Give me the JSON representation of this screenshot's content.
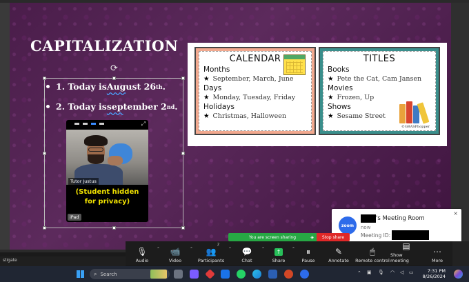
{
  "slide": {
    "title": "CAPITALIZATION",
    "rotate_glyph": "⟳",
    "bullets": [
      {
        "prefix": "1. Today is ",
        "marked": "Aug",
        "rest": "ust 26",
        "sup": "th",
        "end": "."
      },
      {
        "prefix": "2. Today is ",
        "marked": "sep",
        "rest": "tember 2",
        "sup": "nd",
        "end": "."
      }
    ]
  },
  "video": {
    "name_label": "Tutor Justus",
    "hidden_line1": "(Student hidden",
    "hidden_line2": "for privacy)",
    "device_label": "iPad"
  },
  "cards": {
    "calendar": {
      "title": "CALENDAR",
      "sections": [
        {
          "heading": "Months",
          "example": "September, March, June"
        },
        {
          "heading": "Days",
          "example": "Monday, Tuesday, Friday"
        },
        {
          "heading": "Holidays",
          "example": "Christmas, Halloween"
        }
      ]
    },
    "titles": {
      "title": "TITLES",
      "sections": [
        {
          "heading": "Books",
          "example": "Pete the Cat, Cam Jansen"
        },
        {
          "heading": "Movies",
          "example": "Frozen, Up"
        },
        {
          "heading": "Shows",
          "example": "Sesame Street"
        }
      ]
    },
    "star": "★",
    "copyright": "©GRASPhopper"
  },
  "notification": {
    "logo_text": "zoom",
    "room_suffix": "'s Meeting Room",
    "time": "now",
    "meeting_id_label": "Meeting ID:",
    "close": "×"
  },
  "sharing": {
    "banner": "You are screen sharing",
    "stop": "Stop share"
  },
  "toolbar": {
    "participants_count": "2",
    "buttons": [
      {
        "id": "audio",
        "label": "Audio",
        "icon": "🎙"
      },
      {
        "id": "video",
        "label": "Video",
        "icon": "📹"
      },
      {
        "id": "participants",
        "label": "Participants",
        "icon": "👥"
      },
      {
        "id": "chat",
        "label": "Chat",
        "icon": "💬"
      },
      {
        "id": "share",
        "label": "Share",
        "icon": "↑"
      },
      {
        "id": "pause",
        "label": "Pause",
        "icon": "⏸"
      },
      {
        "id": "annotate",
        "label": "Annotate",
        "icon": "✎"
      },
      {
        "id": "remote",
        "label": "Remote control",
        "icon": "🖱"
      },
      {
        "id": "show_meeting",
        "label": "Show meeting",
        "icon": "▤"
      },
      {
        "id": "more",
        "label": "More",
        "icon": "⋯"
      }
    ]
  },
  "left_strip_text": "stigate",
  "taskbar": {
    "search_placeholder": "Search",
    "time": "7:31 PM",
    "date": "8/26/2024",
    "colors": {
      "taskbar_bg": "#202633",
      "accent": "#39a0f5"
    }
  }
}
